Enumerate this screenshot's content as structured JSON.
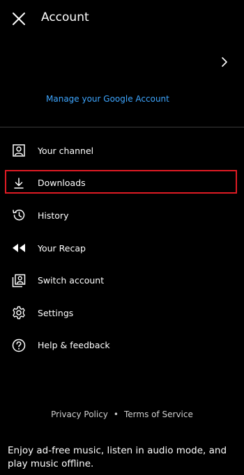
{
  "header": {
    "title": "Account",
    "close_icon": "close-icon"
  },
  "account": {
    "manage_link": "Manage your Google Account",
    "chevron_icon": "chevron-right-icon"
  },
  "menu": {
    "items": [
      {
        "label": "Your channel",
        "icon": "person-icon"
      },
      {
        "label": "Downloads",
        "icon": "download-icon",
        "highlighted": true
      },
      {
        "label": "History",
        "icon": "history-icon"
      },
      {
        "label": "Your Recap",
        "icon": "rewind-icon"
      },
      {
        "label": "Switch account",
        "icon": "switch-account-icon"
      },
      {
        "label": "Settings",
        "icon": "gear-icon"
      },
      {
        "label": "Help & feedback",
        "icon": "help-icon"
      }
    ]
  },
  "footer": {
    "privacy": "Privacy Policy",
    "separator": "•",
    "terms": "Terms of Service"
  },
  "promo": {
    "text": "Enjoy ad-free music, listen in audio mode, and play music offline."
  },
  "colors": {
    "background": "#000000",
    "link": "#3ea6ff",
    "highlight": "#e01b24",
    "divider": "#3a3a3a"
  }
}
